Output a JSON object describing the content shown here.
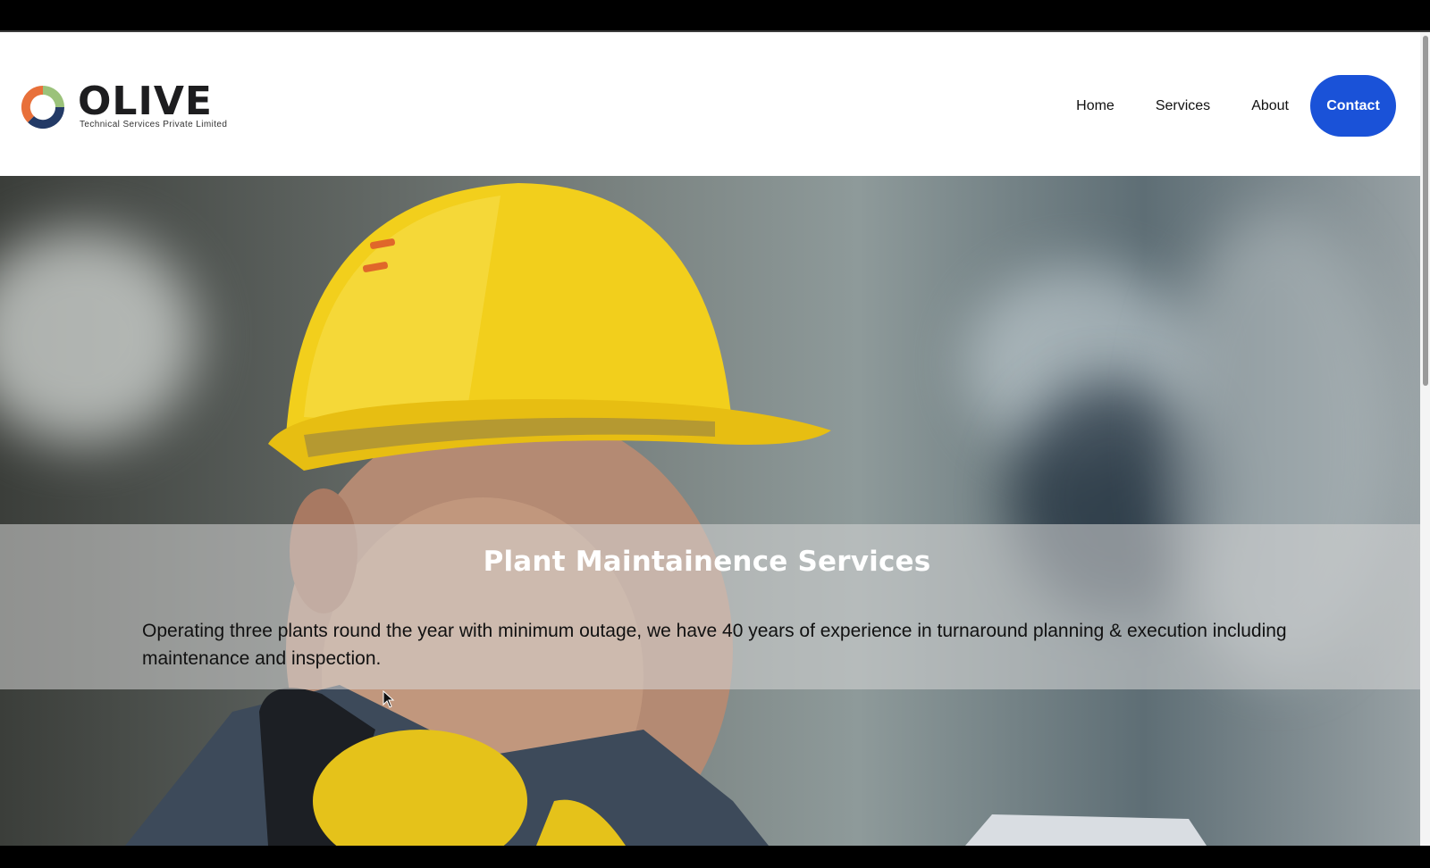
{
  "brand": {
    "name": "OLIVE",
    "tagline": "Technical Services Private Limited",
    "colors": {
      "orange": "#e8703a",
      "green": "#9bc27a",
      "navy": "#233a66"
    }
  },
  "nav": {
    "items": [
      "Home",
      "Services",
      "About"
    ],
    "cta_label": "Contact",
    "cta_color": "#1a52d8"
  },
  "hero": {
    "title": "Plant Maintainence Services",
    "description": "Operating three plants round the year with minimum outage, we have 40 years of experience in turnaround planning & execution including maintenance and inspection.",
    "image_icon": "worker-hardhat-photo"
  }
}
